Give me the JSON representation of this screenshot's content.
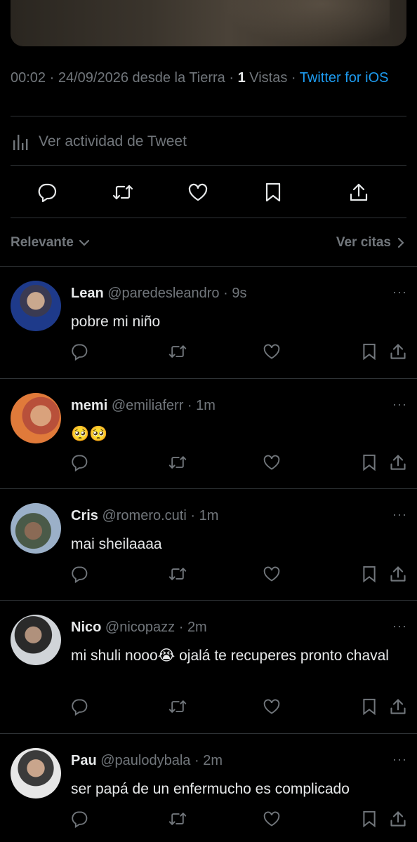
{
  "tweet_meta": {
    "time": "00:02",
    "sep1": " · ",
    "date": "24/09/2026",
    "place": " desde la Tierra · ",
    "views_count": "1",
    "views_label": " Vistas · ",
    "client": "Twitter for iOS"
  },
  "activity": {
    "label": "Ver actividad de Tweet",
    "icon": "stats-icon"
  },
  "actions": {
    "reply": "reply-icon",
    "retweet": "retweet-icon",
    "like": "like-icon",
    "bookmark": "bookmark-icon",
    "share": "share-icon"
  },
  "filter": {
    "left_label": "Relevante",
    "right_label": "Ver citas"
  },
  "replies": [
    {
      "name": "Lean",
      "handle": "@paredesleandro",
      "sep": " · ",
      "time": "9s",
      "text": "pobre mi niño",
      "more": "···"
    },
    {
      "name": "memi",
      "handle": "@emiliaferr",
      "sep": " · ",
      "time": "1m",
      "text": "🥺🥺",
      "more": "···"
    },
    {
      "name": "Cris",
      "handle": "@romero.cuti",
      "sep": " · ",
      "time": "1m",
      "text": "mai sheilaaaa",
      "more": "···"
    },
    {
      "name": "Nico",
      "handle": "@nicopazz",
      "sep": " · ",
      "time": "2m",
      "text_a": "mi shuli nooo",
      "emoji": "😭",
      "text_b": " ojalá te recuperes pronto chaval",
      "more": "···"
    },
    {
      "name": "Pau",
      "handle": "@paulodybala",
      "sep": " · ",
      "time": "2m",
      "text": "ser papá de un enfermucho es complicado",
      "more": "···"
    }
  ],
  "colors": {
    "background": "#000000",
    "text": "#e7e9ea",
    "muted": "#71767b",
    "link": "#1d9bf0",
    "divider": "#2f3336"
  }
}
